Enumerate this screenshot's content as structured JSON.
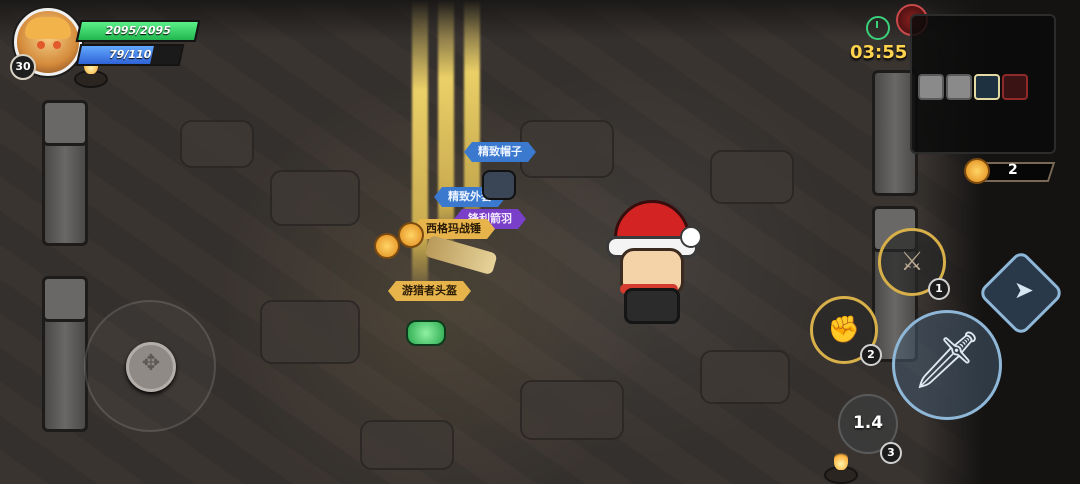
{
  "hud": {
    "level": "30",
    "hp_text": "2095/2095",
    "hp_fraction": 1.0,
    "mp_text": "79/110",
    "mp_fraction": 0.718,
    "timer": "03:55",
    "coins": "2",
    "icons": {
      "timer": "stopwatch-icon",
      "boss": "boss-skull-icon",
      "coin": "crown-coin-icon"
    }
  },
  "minimap": {
    "rooms": [
      {
        "type": "explored"
      },
      {
        "type": "explored"
      },
      {
        "type": "current"
      },
      {
        "type": "boss"
      }
    ]
  },
  "controls": {
    "skills": [
      {
        "name": "skill-1",
        "number": "1",
        "icon": "weapon-emblem-icon"
      },
      {
        "name": "skill-2",
        "number": "2",
        "icon": "fist-emblem-icon"
      }
    ],
    "attack_icon": "sword-icon",
    "dash_icon": "dash-icon",
    "cooldown": {
      "value": "1.4",
      "number": "3",
      "icon": "warrior-silhouette-icon"
    },
    "joystick_icon": "move-arrows-icon"
  },
  "loot": {
    "labels": [
      "精致帽子",
      "精致外套",
      "锋利箭羽",
      "西格玛战锤",
      "游猎者头盔"
    ]
  },
  "colors": {
    "hp": "#2fd06a",
    "mp": "#3a78e6",
    "timer": "#ffd34d",
    "rarity_blue": "#3b79cf",
    "rarity_purple": "#7a3fc8",
    "rarity_gold": "#e6b44a"
  }
}
